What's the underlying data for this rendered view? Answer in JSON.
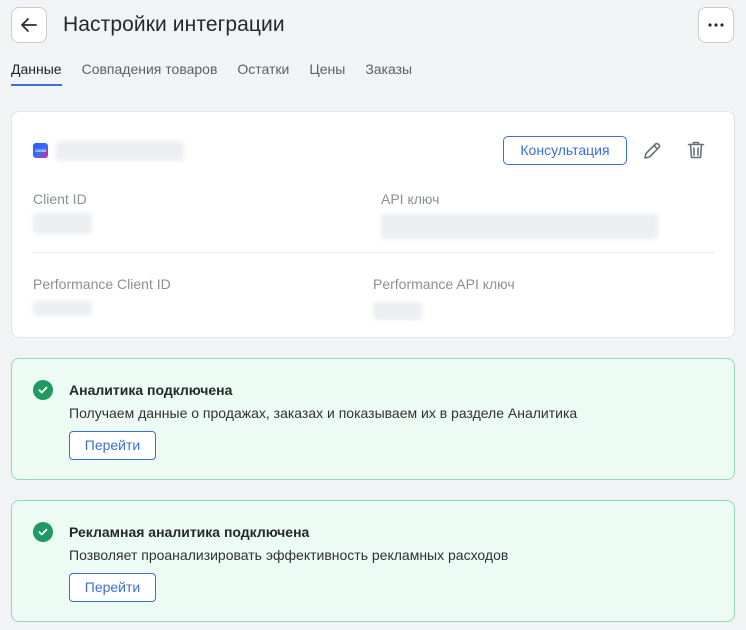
{
  "header": {
    "title": "Настройки интеграции"
  },
  "tabs": [
    {
      "label": "Данные",
      "active": true
    },
    {
      "label": "Совпадения товаров",
      "active": false
    },
    {
      "label": "Остатки",
      "active": false
    },
    {
      "label": "Цены",
      "active": false
    },
    {
      "label": "Заказы",
      "active": false
    }
  ],
  "integration": {
    "logo_text": "OZON",
    "consult_label": "Консультация",
    "fields": {
      "client_id_label": "Client ID",
      "api_key_label": "API ключ",
      "perf_client_id_label": "Performance Client ID",
      "perf_api_key_label": "Performance API ключ"
    }
  },
  "analytics": {
    "title": "Аналитика подключена",
    "description": "Получаем данные о продажах, заказах и показываем их в разделе Аналитика",
    "button_label": "Перейти"
  },
  "ads_analytics": {
    "title": "Рекламная аналитика подключена",
    "description": "Позволяет проанализировать эффективность рекламных расходов",
    "button_label": "Перейти"
  },
  "colors": {
    "accent": "#3a6fd8",
    "success": "#1f9a62",
    "success_bg": "#ecfbf4",
    "success_border": "#97d7b9"
  },
  "icons": [
    "arrow-left-icon",
    "more-horizontal-icon",
    "pencil-icon",
    "trash-icon",
    "check-circle-icon"
  ]
}
